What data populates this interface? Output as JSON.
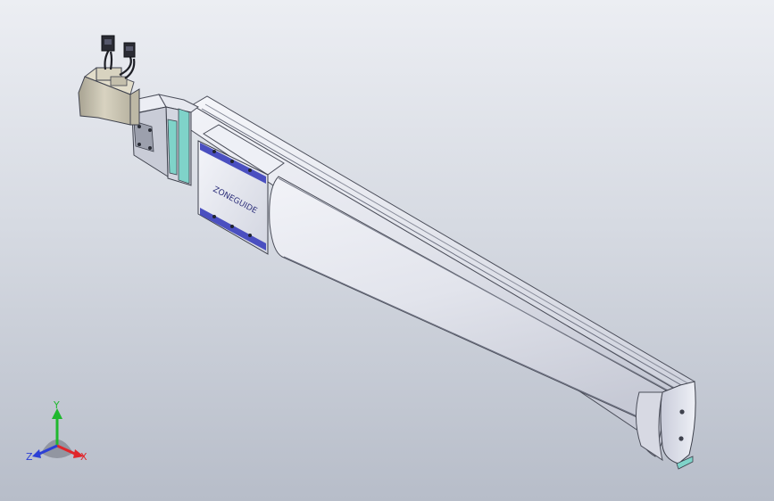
{
  "viewport": {
    "background_top": "#eceef3",
    "background_bottom": "#b7bdc9"
  },
  "model": {
    "carriage_logo_text": "ZONEGUIDE",
    "housing_color": "#d9dbe6",
    "cover_color": "#e4e6ef",
    "accent_color": "#4a4fc0",
    "coupling_ring_color": "#7fd3c9",
    "motor_color": "#cfcab7"
  },
  "triad": {
    "x_label": "X",
    "y_label": "Y",
    "z_label": "Z",
    "x_color": "#e0262b",
    "y_color": "#1fb82e",
    "z_color": "#2b3fd6"
  }
}
